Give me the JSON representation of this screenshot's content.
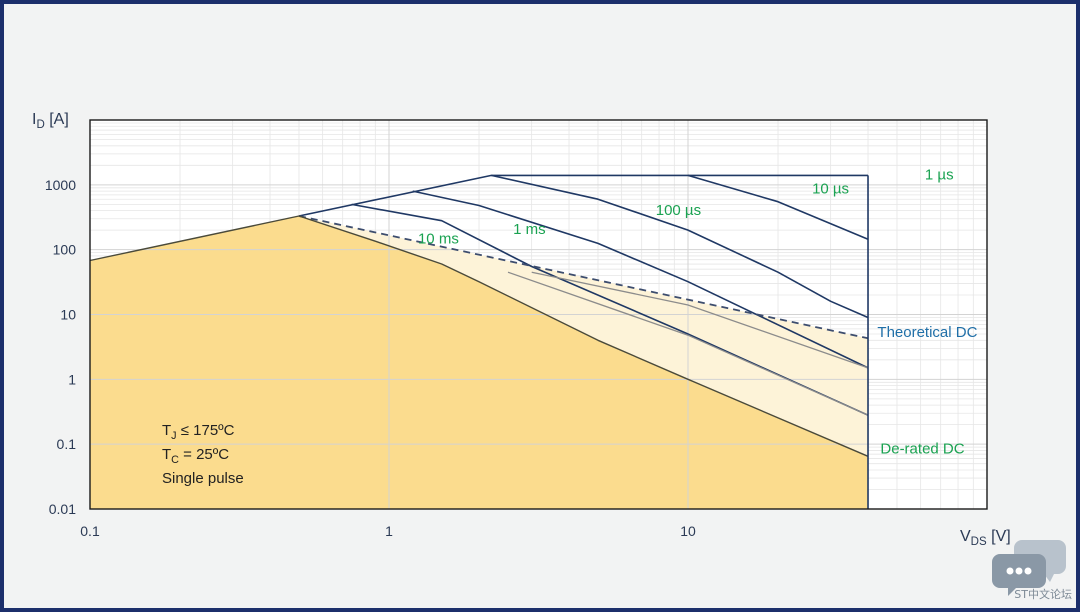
{
  "chart_data": {
    "type": "line",
    "title": "",
    "xlabel": "V",
    "xlabel_sub": "DS",
    "xlabel_unit": " [V]",
    "ylabel": "I",
    "ylabel_sub": "D",
    "ylabel_unit": " [A]",
    "xscale": "log",
    "yscale": "log",
    "xlim": [
      0.1,
      100
    ],
    "ylim": [
      0.01,
      10000
    ],
    "grid": true,
    "x_ticks": [
      {
        "v": 0.1,
        "label": "0.1"
      },
      {
        "v": 1,
        "label": "1"
      },
      {
        "v": 10,
        "label": "10"
      }
    ],
    "y_ticks": [
      {
        "v": 0.01,
        "label": "0.01"
      },
      {
        "v": 0.1,
        "label": "0.1"
      },
      {
        "v": 1,
        "label": "1"
      },
      {
        "v": 10,
        "label": "10"
      },
      {
        "v": 100,
        "label": "100"
      },
      {
        "v": 1000,
        "label": "1000"
      }
    ],
    "fill_derated": [
      [
        0.1,
        68
      ],
      [
        0.5,
        330
      ],
      [
        0.9,
        135
      ],
      [
        1.5,
        60
      ],
      [
        2,
        32
      ],
      [
        5,
        4
      ],
      [
        10,
        1
      ],
      [
        40,
        0.065
      ]
    ],
    "fill_theoretical": [
      [
        0.5,
        330
      ],
      [
        40,
        4.3
      ]
    ],
    "series": [
      {
        "name": "1 µs",
        "points": [
          [
            0.5,
            330
          ],
          [
            2.2,
            1400
          ],
          [
            40,
            1400
          ]
        ]
      },
      {
        "name": "10 µs",
        "points": [
          [
            10,
            1400
          ],
          [
            20,
            550
          ],
          [
            40,
            145
          ]
        ]
      },
      {
        "name": "100 µs",
        "points": [
          [
            2.2,
            1400
          ],
          [
            5,
            600
          ],
          [
            10,
            200
          ],
          [
            20,
            45
          ],
          [
            30,
            16
          ],
          [
            40,
            9
          ]
        ]
      },
      {
        "name": "1 ms",
        "points": [
          [
            1.2,
            800
          ],
          [
            2,
            480
          ],
          [
            5,
            125
          ],
          [
            10,
            32
          ],
          [
            40,
            1.5
          ]
        ]
      },
      {
        "name": "10 ms",
        "points": [
          [
            0.75,
            500
          ],
          [
            1.5,
            280
          ],
          [
            3,
            55
          ],
          [
            10,
            5
          ],
          [
            40,
            0.28
          ]
        ]
      },
      {
        "name": "Theoretical DC",
        "points": [
          [
            0.5,
            330
          ],
          [
            40,
            4.3
          ]
        ]
      },
      {
        "name": "De-rated DC",
        "points": [
          [
            0.1,
            68
          ],
          [
            0.5,
            330
          ],
          [
            0.9,
            135
          ],
          [
            1.5,
            60
          ],
          [
            2,
            32
          ],
          [
            5,
            4
          ],
          [
            10,
            1
          ],
          [
            40,
            0.065
          ]
        ]
      }
    ],
    "boundary_vmax": 40,
    "annotations": [
      {
        "key": "1us",
        "text": "1 µs",
        "x": 62,
        "y": 1450
      },
      {
        "key": "10us",
        "text": "10 µs",
        "x": 26,
        "y": 880
      },
      {
        "key": "100us",
        "text": "100 µs",
        "x": 7.8,
        "y": 410
      },
      {
        "key": "1ms",
        "text": "1 ms",
        "x": 2.6,
        "y": 210
      },
      {
        "key": "10ms",
        "text": "10 ms",
        "x": 1.25,
        "y": 150
      },
      {
        "key": "theo",
        "text": "Theoretical DC",
        "x": 43,
        "y": 5.4
      },
      {
        "key": "derated",
        "text": "De-rated DC",
        "x": 44,
        "y": 0.085
      }
    ],
    "conditions": [
      {
        "main": "T",
        "sub": "J",
        "rest": " ≤ 175ºC"
      },
      {
        "main": "T",
        "sub": "C",
        "rest": " = 25ºC"
      },
      {
        "main": "Single pulse",
        "sub": "",
        "rest": ""
      }
    ],
    "colors": {
      "frame": "#1c2f6b",
      "background": "#f2f3f3",
      "plot_bg": "#ffffff",
      "curve": "#1f3864",
      "derated_fill": "#fbdc8e",
      "theoretical_fill": "#fdf3d8",
      "gray_curve": "#8c8c8c",
      "annotation_green": "#1aa251",
      "annotation_blue": "#1f6fa8",
      "axis_text": "#2b3a55"
    }
  },
  "watermark": {
    "icon": "chat-bubbles-icon",
    "text": "ST中文论坛"
  }
}
